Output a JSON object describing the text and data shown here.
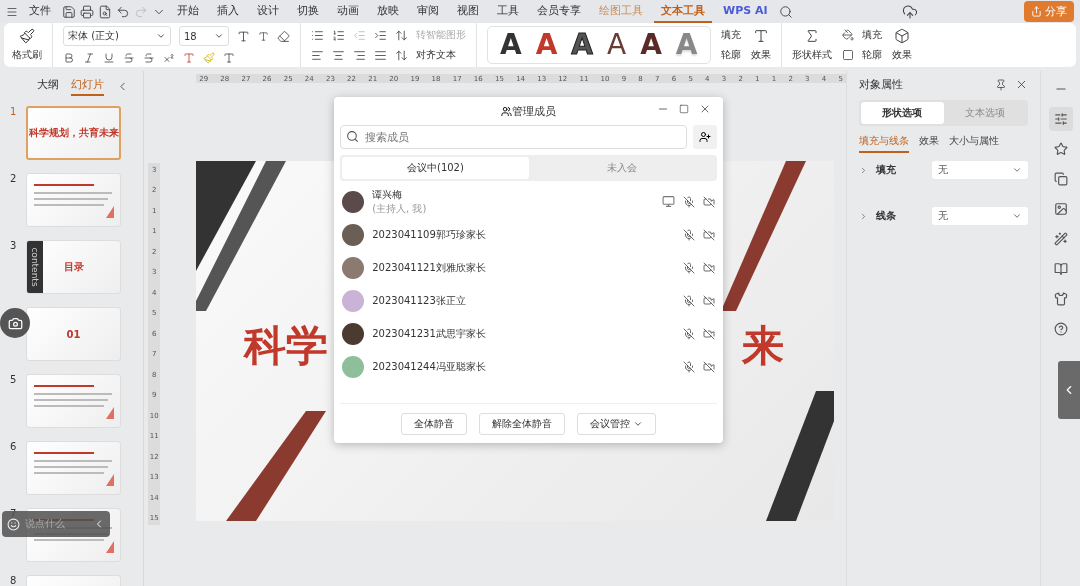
{
  "menu_bar": {
    "file": "文件",
    "tabs": [
      {
        "label": "开始",
        "selected": false,
        "kind": "normal"
      },
      {
        "label": "插入",
        "selected": false,
        "kind": "normal"
      },
      {
        "label": "设计",
        "selected": false,
        "kind": "normal"
      },
      {
        "label": "切换",
        "selected": false,
        "kind": "normal"
      },
      {
        "label": "动画",
        "selected": false,
        "kind": "normal"
      },
      {
        "label": "放映",
        "selected": false,
        "kind": "normal"
      },
      {
        "label": "审阅",
        "selected": false,
        "kind": "normal"
      },
      {
        "label": "视图",
        "selected": false,
        "kind": "normal"
      },
      {
        "label": "工具",
        "selected": false,
        "kind": "normal"
      },
      {
        "label": "会员专享",
        "selected": false,
        "kind": "normal"
      },
      {
        "label": "绘图工具",
        "selected": false,
        "kind": "context"
      },
      {
        "label": "文本工具",
        "selected": true,
        "kind": "context"
      },
      {
        "label": "WPS AI",
        "selected": false,
        "kind": "ai"
      }
    ],
    "share": "分享"
  },
  "ribbon": {
    "format_painter": "格式刷",
    "font": "宋体 (正文)",
    "size": "18",
    "smart_art": {
      "label": "转智能图形",
      "disabled": true
    },
    "align_text": "对齐文本",
    "art_styles": [
      {
        "letter": "A",
        "kind": "solid",
        "color": "#333333"
      },
      {
        "letter": "A",
        "kind": "solid",
        "color": "#c0392b"
      },
      {
        "letter": "A",
        "kind": "outline",
        "color": "#555555"
      },
      {
        "letter": "A",
        "kind": "hollow",
        "color": "#6b3b36"
      },
      {
        "letter": "A",
        "kind": "solid",
        "color": "#5a2a27"
      },
      {
        "letter": "A",
        "kind": "fade",
        "color": "#888888"
      }
    ],
    "text_fill": "填充",
    "text_outline": "轮廓",
    "text_effect": "效果",
    "shape_style": "形状样式",
    "shape_fill": "填充",
    "shape_outline": "轮廓",
    "shape_effect": "效果"
  },
  "left_panel": {
    "tabs": [
      {
        "label": "大纲",
        "selected": false
      },
      {
        "label": "幻灯片",
        "selected": true
      }
    ],
    "slides": [
      {
        "number": "1",
        "kind": "title",
        "title": "科学规划，共育未来",
        "selected": true
      },
      {
        "number": "2",
        "kind": "text",
        "selected": false
      },
      {
        "number": "3",
        "kind": "contents",
        "title": "目录",
        "side": "contents",
        "selected": false
      },
      {
        "kind": "section",
        "title": "01",
        "selected": false
      },
      {
        "number": "5",
        "kind": "text",
        "selected": false
      },
      {
        "number": "6",
        "kind": "text",
        "selected": false
      },
      {
        "number": "7",
        "kind": "text",
        "selected": false
      },
      {
        "number": "8",
        "kind": "text",
        "selected": false
      }
    ]
  },
  "ruler": {
    "horizontal": [
      "29",
      "28",
      "27",
      "26",
      "25",
      "24",
      "23",
      "22",
      "21",
      "20",
      "19",
      "18",
      "17",
      "16",
      "15",
      "14",
      "13",
      "12",
      "11",
      "10",
      "9",
      "8",
      "7",
      "6",
      "5",
      "4",
      "3",
      "2",
      "1",
      "1",
      "2",
      "3",
      "4",
      "5"
    ],
    "vertical": [
      "3",
      "2",
      "1",
      "1",
      "2",
      "3",
      "4",
      "5",
      "6",
      "7",
      "8",
      "9",
      "10",
      "11",
      "12",
      "13",
      "14",
      "15"
    ]
  },
  "slide": {
    "title_left": "科学",
    "title_right": "来"
  },
  "members_dialog": {
    "title": "管理成员",
    "search": {
      "placeholder": "搜索成员"
    },
    "tabs": [
      {
        "label": "会议中(102)",
        "selected": true
      },
      {
        "label": "未入会",
        "selected": false
      }
    ],
    "members": [
      {
        "name": "谭兴梅",
        "role": "(主持人, 我)",
        "sharing": true,
        "color": "#5a4a4a"
      },
      {
        "name": "2023041109郭巧珍家长",
        "sharing": false,
        "color": "#6b5f55"
      },
      {
        "name": "2023041121刘雅欣家长",
        "sharing": false,
        "color": "#8a7a70"
      },
      {
        "name": "2023041123张正立",
        "sharing": false,
        "color": "#c9b3d6"
      },
      {
        "name": "2023041231武思宇家长",
        "sharing": false,
        "color": "#4a3a30"
      },
      {
        "name": "2023041244冯亚聪家长",
        "sharing": false,
        "color": "#8fbf9a"
      }
    ],
    "buttons": [
      {
        "label": "全体静音",
        "kind": "plain"
      },
      {
        "label": "解除全体静音",
        "kind": "plain"
      },
      {
        "label": "会议管控",
        "kind": "menu"
      }
    ]
  },
  "properties_panel": {
    "title": "对象属性",
    "tabs": [
      {
        "label": "形状选项",
        "selected": true
      },
      {
        "label": "文本选项",
        "selected": false
      }
    ],
    "subtabs": [
      {
        "label": "填充与线条",
        "selected": true
      },
      {
        "label": "效果",
        "selected": false
      },
      {
        "label": "大小与属性",
        "selected": false
      }
    ],
    "rows": [
      {
        "label": "填充",
        "value": "无"
      },
      {
        "label": "线条",
        "value": "无"
      }
    ]
  },
  "chat_bar": {
    "placeholder": "说点什么"
  }
}
